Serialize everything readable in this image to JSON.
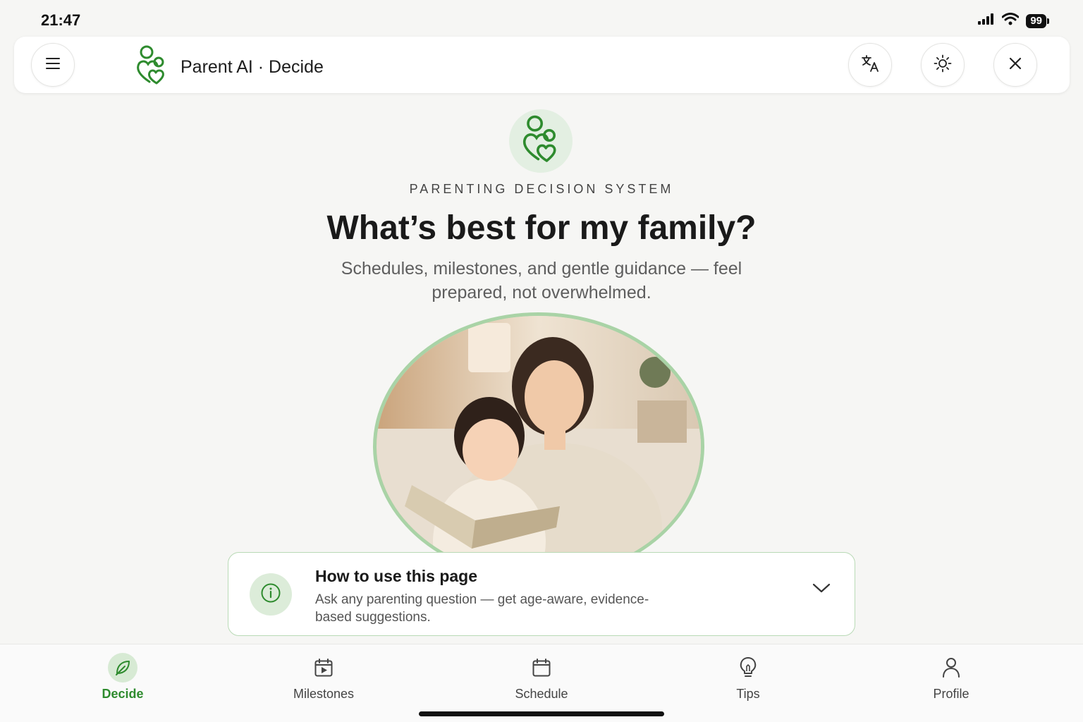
{
  "status_bar": {
    "time": "21:47",
    "battery": "99",
    "icons": [
      "signal-icon",
      "wifi-icon",
      "battery-icon"
    ]
  },
  "app_bar": {
    "title": "Parent AI · Decide",
    "buttons": [
      "menu-icon",
      "translate-icon",
      "sun-icon",
      "close-icon"
    ]
  },
  "hero": {
    "eyebrow": "PARENTING DECISION SYSTEM",
    "headline": "What’s best for my family?",
    "subtitle": "Schedules, milestones, and gentle guidance — feel prepared, not overwhelmed."
  },
  "info_card": {
    "title": "How to use this page",
    "body": "Ask any parenting question — get age-aware, evidence-based suggestions."
  },
  "bottom_nav": {
    "items": [
      {
        "label": "Decide",
        "icon": "leaf-icon",
        "active": true
      },
      {
        "label": "Milestones",
        "icon": "calendar-play-icon",
        "active": false
      },
      {
        "label": "Schedule",
        "icon": "calendar-icon",
        "active": false
      },
      {
        "label": "Tips",
        "icon": "lightbulb-icon",
        "active": false
      },
      {
        "label": "Profile",
        "icon": "person-icon",
        "active": false
      }
    ]
  },
  "colors": {
    "accent": "#2e8b2e",
    "accent_soft": "#dcecd9",
    "card_border": "#b9dab6",
    "background": "#f6f6f4"
  }
}
